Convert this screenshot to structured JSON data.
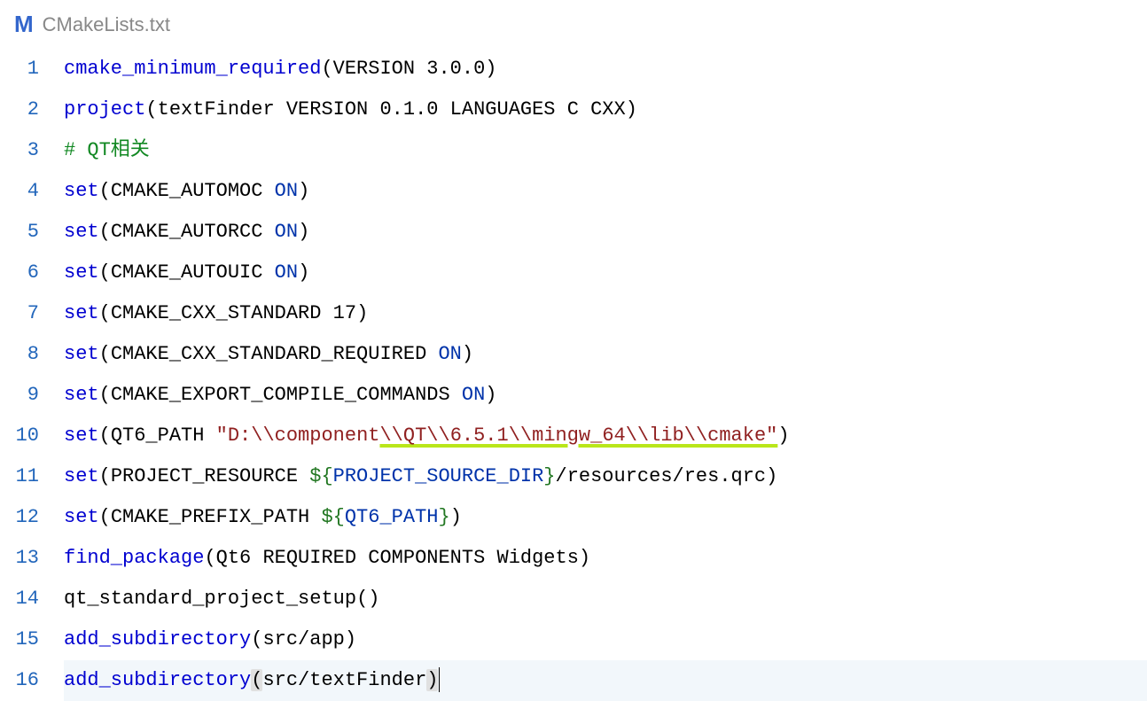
{
  "header": {
    "icon_glyph": "M",
    "filename": "CMakeLists.txt"
  },
  "line_numbers": [
    "1",
    "2",
    "3",
    "4",
    "5",
    "6",
    "7",
    "8",
    "9",
    "10",
    "11",
    "12",
    "13",
    "14",
    "15",
    "16"
  ],
  "lines": {
    "l1": {
      "fn": "cmake_minimum_required",
      "arg": "VERSION 3.0.0"
    },
    "l2": {
      "fn": "project",
      "arg": "textFinder VERSION 0.1.0 LANGUAGES C CXX"
    },
    "l3": {
      "comment": "# QT相关"
    },
    "l4": {
      "fn": "set",
      "var": "CMAKE_AUTOMOC",
      "val": "ON"
    },
    "l5": {
      "fn": "set",
      "var": "CMAKE_AUTORCC",
      "val": "ON"
    },
    "l6": {
      "fn": "set",
      "var": "CMAKE_AUTOUIC",
      "val": "ON"
    },
    "l7": {
      "fn": "set",
      "var": "CMAKE_CXX_STANDARD",
      "num": "17"
    },
    "l8": {
      "fn": "set",
      "var": "CMAKE_CXX_STANDARD_REQUIRED",
      "val": "ON"
    },
    "l9": {
      "fn": "set",
      "var": "CMAKE_EXPORT_COMPILE_COMMANDS",
      "val": "ON"
    },
    "l10": {
      "fn": "set",
      "var": "QT6_PATH",
      "str_q": "\"",
      "str_head": "D:\\\\component",
      "str_ul": "\\\\QT\\\\6.5.1\\\\mingw_64\\\\lib\\\\cmake\""
    },
    "l11": {
      "fn": "set",
      "var": "PROJECT_RESOURCE",
      "dollar": "$",
      "ob": "{",
      "ref": "PROJECT_SOURCE_DIR",
      "cb": "}",
      "tail": "/resources/res.qrc"
    },
    "l12": {
      "fn": "set",
      "var": "CMAKE_PREFIX_PATH",
      "dollar": "$",
      "ob": "{",
      "ref": "QT6_PATH",
      "cb": "}"
    },
    "l13": {
      "fn": "find_package",
      "arg": "Qt6 REQUIRED COMPONENTS Widgets"
    },
    "l14": {
      "fn": "qt_standard_project_setup"
    },
    "l15": {
      "fn": "add_subdirectory",
      "arg": "src/app"
    },
    "l16": {
      "fn": "add_subdirectory",
      "arg": "src/textFinder"
    }
  }
}
